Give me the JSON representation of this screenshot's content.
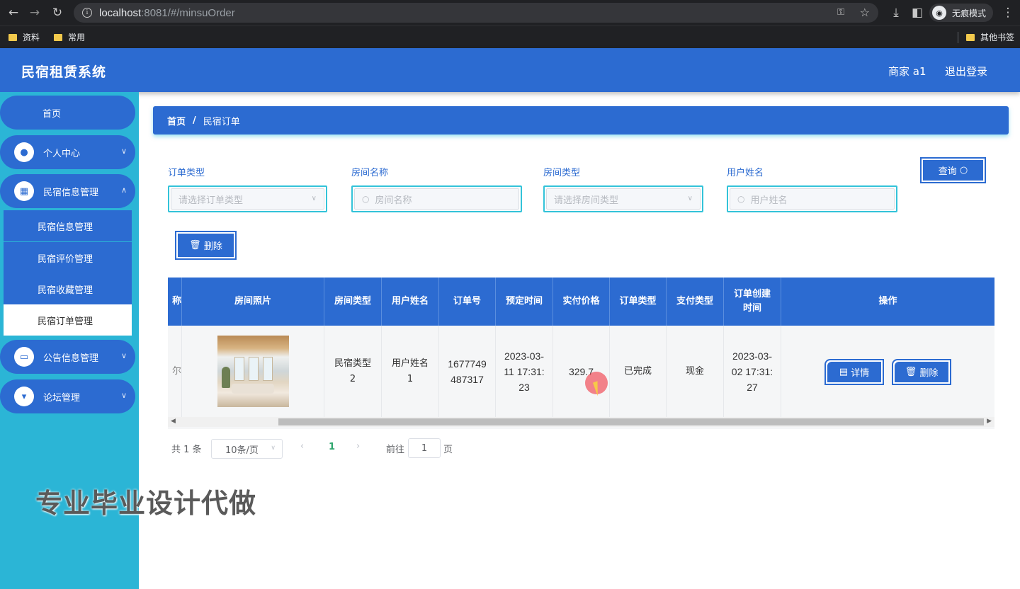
{
  "browser": {
    "url_host": "localhost",
    "url_path": ":8081/#/minsuOrder",
    "incognito_label": "无痕模式",
    "bookmarks": [
      "资料",
      "常用"
    ],
    "other_bookmarks": "其他书签"
  },
  "header": {
    "title": "民宿租赁系统",
    "user": "商家 a1",
    "logout": "退出登录"
  },
  "sidebar": {
    "items": [
      {
        "label": "首页"
      },
      {
        "label": "个人中心"
      },
      {
        "label": "民宿信息管理"
      },
      {
        "label": "公告信息管理"
      },
      {
        "label": "论坛管理"
      }
    ],
    "submenu": [
      {
        "label": "民宿信息管理"
      },
      {
        "label": "民宿评价管理"
      },
      {
        "label": "民宿收藏管理"
      },
      {
        "label": "民宿订单管理"
      }
    ]
  },
  "watermark": "专业毕业设计代做",
  "breadcrumb": {
    "home": "首页",
    "sep": "/",
    "current": "民宿订单"
  },
  "filters": {
    "order_type": {
      "label": "订单类型",
      "placeholder": "请选择订单类型"
    },
    "room_name": {
      "label": "房间名称",
      "placeholder": "房间名称"
    },
    "room_type": {
      "label": "房间类型",
      "placeholder": "请选择房间类型"
    },
    "user_name": {
      "label": "用户姓名",
      "placeholder": "用户姓名"
    }
  },
  "buttons": {
    "query": "查询",
    "delete": "删除"
  },
  "table": {
    "headers": {
      "partial": "称",
      "photo": "房间照片",
      "room_type": "房间类型",
      "user_name": "用户姓名",
      "order_no": "订单号",
      "book_time": "预定时间",
      "price": "实付价格",
      "order_type": "订单类型",
      "pay_type": "支付类型",
      "created": "订单创建时间",
      "ops": "操作"
    },
    "rows": [
      {
        "partial": "尔",
        "room_type": "民宿类型2",
        "user_name": "用户姓名1",
        "order_no": "1677749487317",
        "book_time": "2023-03-11 17:31:23",
        "price": "329.7",
        "order_type": "已完成",
        "pay_type": "现金",
        "created": "2023-03-02 17:31:27",
        "detail_label": "详情",
        "delete_label": "删除"
      }
    ]
  },
  "pagination": {
    "total": "共 1 条",
    "page_size": "10条/页",
    "current": "1",
    "goto": "前往",
    "goto_value": "1",
    "page_unit": "页"
  }
}
